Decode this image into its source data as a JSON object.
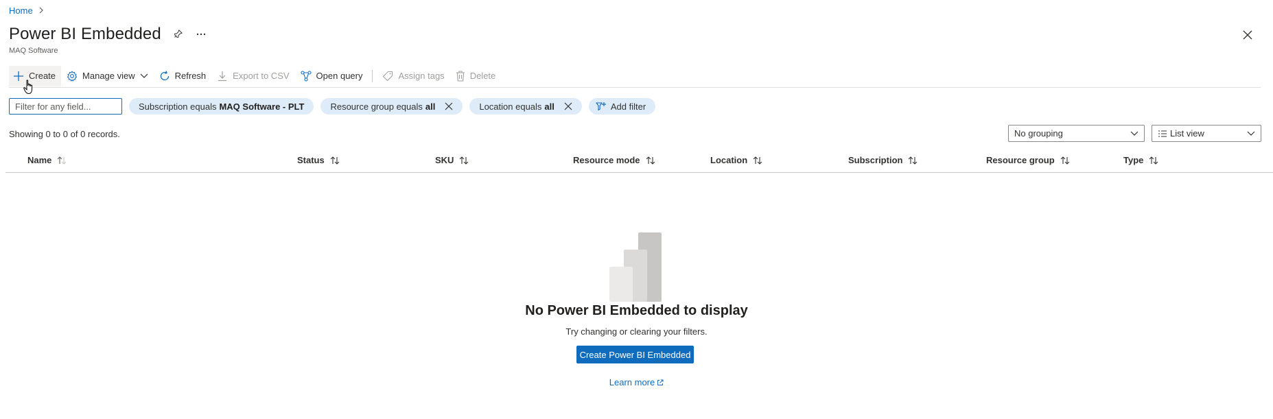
{
  "breadcrumb": {
    "home": "Home"
  },
  "header": {
    "title": "Power BI Embedded",
    "subtitle": "MAQ Software"
  },
  "toolbar": {
    "create": "Create",
    "manage_view": "Manage view",
    "refresh": "Refresh",
    "export_csv": "Export to CSV",
    "open_query": "Open query",
    "assign_tags": "Assign tags",
    "delete": "Delete"
  },
  "filters": {
    "search_placeholder": "Filter for any field...",
    "subscription": {
      "prefix": "Subscription equals",
      "value": "MAQ Software - PLT"
    },
    "resource_group": {
      "prefix": "Resource group equals",
      "value": "all"
    },
    "location": {
      "prefix": "Location equals",
      "value": "all"
    },
    "add_filter": "Add filter"
  },
  "records_text": "Showing 0 to 0 of 0 records.",
  "grouping": {
    "selected": "No grouping"
  },
  "view": {
    "selected": "List view"
  },
  "columns": [
    "Name",
    "Status",
    "SKU",
    "Resource mode",
    "Location",
    "Subscription",
    "Resource group",
    "Type"
  ],
  "empty_state": {
    "title": "No Power BI Embedded to display",
    "subtitle": "Try changing or clearing your filters.",
    "button": "Create Power BI Embedded",
    "learn_more": "Learn more"
  },
  "colors": {
    "accent": "#0f6cbd",
    "pill_bg": "#deecf9"
  }
}
